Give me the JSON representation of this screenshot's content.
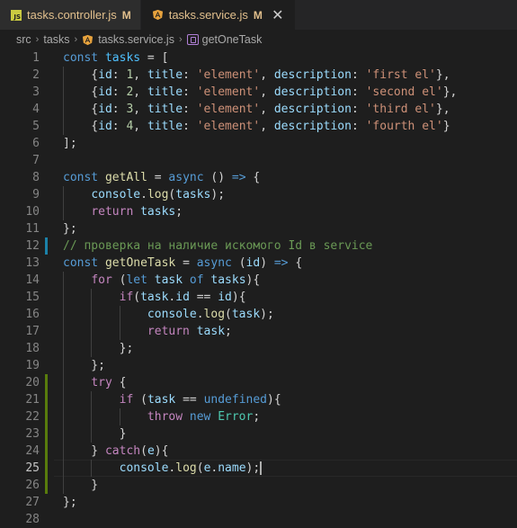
{
  "tabs": [
    {
      "icon": "js-icon",
      "name": "tasks.controller.js",
      "status": "M",
      "active": false
    },
    {
      "icon": "angular-icon",
      "name": "tasks.service.js",
      "status": "M",
      "active": true,
      "close": "✕"
    }
  ],
  "breadcrumb": {
    "items": [
      "src",
      "tasks",
      "tasks.service.js",
      "getOneTask"
    ],
    "separator": "›"
  },
  "colors": {
    "keyword": "#569cd6",
    "control": "#c586c0",
    "variable": "#9cdcfe",
    "const": "#4fc1ff",
    "function": "#dcdcaa",
    "string": "#ce9178",
    "number": "#b5cea8",
    "class": "#4ec9b0",
    "comment": "#6a9955",
    "modified_bar": "#1b81a8",
    "added_bar": "#587c0c"
  },
  "editor": {
    "active_line": 25,
    "lines": [
      {
        "n": "1",
        "tokens": [
          [
            "kw",
            "const "
          ],
          [
            "cst",
            "tasks"
          ],
          [
            "pun",
            " = ["
          ]
        ]
      },
      {
        "n": "2",
        "tokens": [
          [
            "pun",
            "    {"
          ],
          [
            "var",
            "id"
          ],
          [
            "pun",
            ": "
          ],
          [
            "num",
            "1"
          ],
          [
            "pun",
            ", "
          ],
          [
            "var",
            "title"
          ],
          [
            "pun",
            ": "
          ],
          [
            "str",
            "'element'"
          ],
          [
            "pun",
            ", "
          ],
          [
            "var",
            "description"
          ],
          [
            "pun",
            ": "
          ],
          [
            "str",
            "'first el'"
          ],
          [
            "pun",
            "},"
          ]
        ]
      },
      {
        "n": "3",
        "tokens": [
          [
            "pun",
            "    {"
          ],
          [
            "var",
            "id"
          ],
          [
            "pun",
            ": "
          ],
          [
            "num",
            "2"
          ],
          [
            "pun",
            ", "
          ],
          [
            "var",
            "title"
          ],
          [
            "pun",
            ": "
          ],
          [
            "str",
            "'element'"
          ],
          [
            "pun",
            ", "
          ],
          [
            "var",
            "description"
          ],
          [
            "pun",
            ": "
          ],
          [
            "str",
            "'second el'"
          ],
          [
            "pun",
            "},"
          ]
        ]
      },
      {
        "n": "4",
        "tokens": [
          [
            "pun",
            "    {"
          ],
          [
            "var",
            "id"
          ],
          [
            "pun",
            ": "
          ],
          [
            "num",
            "3"
          ],
          [
            "pun",
            ", "
          ],
          [
            "var",
            "title"
          ],
          [
            "pun",
            ": "
          ],
          [
            "str",
            "'element'"
          ],
          [
            "pun",
            ", "
          ],
          [
            "var",
            "description"
          ],
          [
            "pun",
            ": "
          ],
          [
            "str",
            "'third el'"
          ],
          [
            "pun",
            "},"
          ]
        ]
      },
      {
        "n": "5",
        "tokens": [
          [
            "pun",
            "    {"
          ],
          [
            "var",
            "id"
          ],
          [
            "pun",
            ": "
          ],
          [
            "num",
            "4"
          ],
          [
            "pun",
            ", "
          ],
          [
            "var",
            "title"
          ],
          [
            "pun",
            ": "
          ],
          [
            "str",
            "'element'"
          ],
          [
            "pun",
            ", "
          ],
          [
            "var",
            "description"
          ],
          [
            "pun",
            ": "
          ],
          [
            "str",
            "'fourth el'"
          ],
          [
            "pun",
            "}"
          ]
        ]
      },
      {
        "n": "6",
        "tokens": [
          [
            "pun",
            "];"
          ]
        ]
      },
      {
        "n": "7",
        "tokens": []
      },
      {
        "n": "8",
        "tokens": [
          [
            "kw",
            "const "
          ],
          [
            "fn",
            "getAll"
          ],
          [
            "pun",
            " = "
          ],
          [
            "kw",
            "async"
          ],
          [
            "pun",
            " () "
          ],
          [
            "kw",
            "=>"
          ],
          [
            "pun",
            " {"
          ]
        ]
      },
      {
        "n": "9",
        "tokens": [
          [
            "pun",
            "    "
          ],
          [
            "var",
            "console"
          ],
          [
            "pun",
            "."
          ],
          [
            "fn",
            "log"
          ],
          [
            "pun",
            "("
          ],
          [
            "var",
            "tasks"
          ],
          [
            "pun",
            ");"
          ]
        ]
      },
      {
        "n": "10",
        "tokens": [
          [
            "pun",
            "    "
          ],
          [
            "ctl",
            "return "
          ],
          [
            "var",
            "tasks"
          ],
          [
            "pun",
            ";"
          ]
        ]
      },
      {
        "n": "11",
        "tokens": [
          [
            "pun",
            "};"
          ]
        ]
      },
      {
        "n": "12",
        "tokens": [
          [
            "cmt",
            "// проверка на наличие искомого Id в service"
          ]
        ],
        "bar": "modified"
      },
      {
        "n": "13",
        "tokens": [
          [
            "kw",
            "const "
          ],
          [
            "fn",
            "getOneTask"
          ],
          [
            "pun",
            " = "
          ],
          [
            "kw",
            "async"
          ],
          [
            "pun",
            " ("
          ],
          [
            "var",
            "id"
          ],
          [
            "pun",
            ") "
          ],
          [
            "kw",
            "=>"
          ],
          [
            "pun",
            " {"
          ]
        ]
      },
      {
        "n": "14",
        "tokens": [
          [
            "pun",
            "    "
          ],
          [
            "ctl",
            "for"
          ],
          [
            "pun",
            " ("
          ],
          [
            "kw",
            "let "
          ],
          [
            "var",
            "task"
          ],
          [
            "pun",
            " "
          ],
          [
            "kw",
            "of "
          ],
          [
            "var",
            "tasks"
          ],
          [
            "pun",
            "){"
          ]
        ]
      },
      {
        "n": "15",
        "tokens": [
          [
            "pun",
            "        "
          ],
          [
            "ctl",
            "if"
          ],
          [
            "pun",
            "("
          ],
          [
            "var",
            "task"
          ],
          [
            "pun",
            "."
          ],
          [
            "var",
            "id"
          ],
          [
            "pun",
            " == "
          ],
          [
            "var",
            "id"
          ],
          [
            "pun",
            "){"
          ]
        ]
      },
      {
        "n": "16",
        "tokens": [
          [
            "pun",
            "            "
          ],
          [
            "var",
            "console"
          ],
          [
            "pun",
            "."
          ],
          [
            "fn",
            "log"
          ],
          [
            "pun",
            "("
          ],
          [
            "var",
            "task"
          ],
          [
            "pun",
            ");"
          ]
        ]
      },
      {
        "n": "17",
        "tokens": [
          [
            "pun",
            "            "
          ],
          [
            "ctl",
            "return "
          ],
          [
            "var",
            "task"
          ],
          [
            "pun",
            ";"
          ]
        ]
      },
      {
        "n": "18",
        "tokens": [
          [
            "pun",
            "        };"
          ]
        ]
      },
      {
        "n": "19",
        "tokens": [
          [
            "pun",
            "    };"
          ]
        ]
      },
      {
        "n": "20",
        "tokens": [
          [
            "pun",
            "    "
          ],
          [
            "ctl",
            "try"
          ],
          [
            "pun",
            " {"
          ]
        ],
        "bar": "added"
      },
      {
        "n": "21",
        "tokens": [
          [
            "pun",
            "        "
          ],
          [
            "ctl",
            "if"
          ],
          [
            "pun",
            " ("
          ],
          [
            "var",
            "task"
          ],
          [
            "pun",
            " == "
          ],
          [
            "kw",
            "undefined"
          ],
          [
            "pun",
            "){"
          ]
        ],
        "bar": "added"
      },
      {
        "n": "22",
        "tokens": [
          [
            "pun",
            "            "
          ],
          [
            "ctl",
            "throw "
          ],
          [
            "kw",
            "new "
          ],
          [
            "cls",
            "Error"
          ],
          [
            "pun",
            ";"
          ]
        ],
        "bar": "added"
      },
      {
        "n": "23",
        "tokens": [
          [
            "pun",
            "        }"
          ]
        ],
        "bar": "added"
      },
      {
        "n": "24",
        "tokens": [
          [
            "pun",
            "    } "
          ],
          [
            "ctl",
            "catch"
          ],
          [
            "pun",
            "("
          ],
          [
            "var",
            "e"
          ],
          [
            "pun",
            ")"
          ],
          [
            "pun",
            "{"
          ]
        ],
        "bar": "added"
      },
      {
        "n": "25",
        "tokens": [
          [
            "pun",
            "        "
          ],
          [
            "var",
            "console"
          ],
          [
            "pun",
            "."
          ],
          [
            "fn",
            "log"
          ],
          [
            "pun",
            "("
          ],
          [
            "var",
            "e"
          ],
          [
            "pun",
            "."
          ],
          [
            "var",
            "name"
          ],
          [
            "pun",
            ");"
          ]
        ],
        "bar": "added"
      },
      {
        "n": "26",
        "tokens": [
          [
            "pun",
            "    }"
          ]
        ],
        "bar": "added"
      },
      {
        "n": "27",
        "tokens": [
          [
            "pun",
            "};"
          ]
        ]
      },
      {
        "n": "28",
        "tokens": []
      }
    ]
  }
}
